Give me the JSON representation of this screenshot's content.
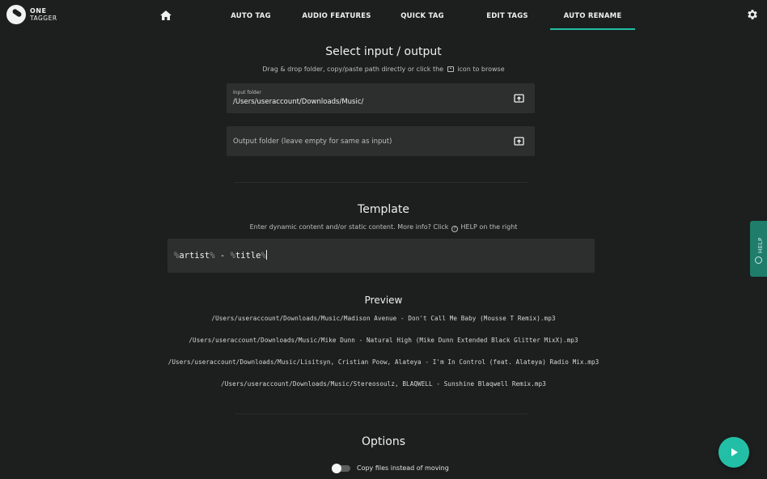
{
  "app": {
    "logo_line1": "ONE",
    "logo_line2": "TAGGER"
  },
  "nav": {
    "home_icon": "home-icon",
    "tabs": [
      {
        "label": "AUTO TAG"
      },
      {
        "label": "AUDIO FEATURES"
      },
      {
        "label": "QUICK TAG"
      },
      {
        "label": "EDIT TAGS"
      },
      {
        "label": "AUTO RENAME",
        "active": true
      }
    ],
    "settings_icon": "gear-icon"
  },
  "io": {
    "title": "Select input / output",
    "subtitle_before": "Drag & drop folder, copy/paste path directly or click the",
    "subtitle_after": "icon to browse",
    "input_label": "Input folder",
    "input_value": "/Users/useraccount/Downloads/Music/",
    "output_placeholder": "Output folder (leave empty for same as input)"
  },
  "template": {
    "title": "Template",
    "subtitle_before": "Enter dynamic content and/or static content. More info? Click",
    "subtitle_after": "HELP on the right",
    "pct": "%",
    "var1": "artist",
    "sep": " - ",
    "var2": "title"
  },
  "preview": {
    "title": "Preview",
    "lines": [
      "/Users/useraccount/Downloads/Music/Madison Avenue - Don't Call Me Baby (Mousse T Remix).mp3",
      "/Users/useraccount/Downloads/Music/Mike Dunn - Natural High (Mike Dunn Extended Black Glitter MixX).mp3",
      "/Users/useraccount/Downloads/Music/Lisitsyn, Cristian Poow, Alateya - I'm In Control (feat. Alateya) Radio Mix.mp3",
      "/Users/useraccount/Downloads/Music/Stereosoulz, BLAQWELL - Sunshine Blaqwell Remix.mp3"
    ]
  },
  "options": {
    "title": "Options",
    "copy_label": "Copy files instead of moving",
    "copy_enabled": false
  },
  "help_tab": {
    "label": "HELP"
  },
  "colors": {
    "accent": "#22bfa6",
    "background": "#1d1f1f",
    "field": "#2d2f2f"
  }
}
